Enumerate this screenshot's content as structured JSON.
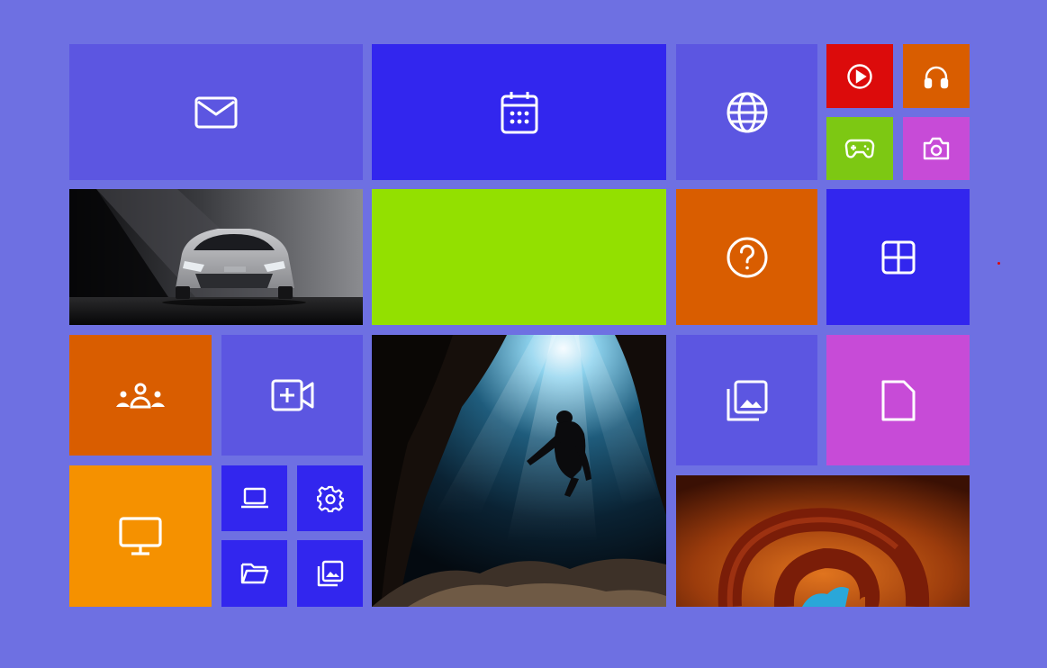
{
  "colors": {
    "background": "#6e70e2",
    "indigo": "#5c56e1",
    "blue": "#3226ee",
    "lime": "#93e000",
    "orange": "#d95d00",
    "amber": "#f59100",
    "red": "#dc0b0b",
    "magenta": "#c74bd7",
    "green": "#7dc813"
  },
  "tiles": [
    {
      "name": "mail-tile",
      "icon": "mail-icon"
    },
    {
      "name": "calendar-tile",
      "icon": "calendar-icon"
    },
    {
      "name": "browser-tile",
      "icon": "globe-icon"
    },
    {
      "name": "video-player-tile",
      "icon": "play-circle-icon"
    },
    {
      "name": "music-tile",
      "icon": "headphones-icon"
    },
    {
      "name": "games-tile",
      "icon": "gamepad-icon"
    },
    {
      "name": "camera-tile",
      "icon": "camera-icon"
    },
    {
      "name": "car-photo-tile",
      "icon": "car-photo"
    },
    {
      "name": "lime-tile",
      "icon": ""
    },
    {
      "name": "help-tile",
      "icon": "help-circle-icon"
    },
    {
      "name": "windows-tile",
      "icon": "windows-icon"
    },
    {
      "name": "people-tile",
      "icon": "people-icon"
    },
    {
      "name": "video-call-tile",
      "icon": "video-add-icon"
    },
    {
      "name": "diver-photo-tile",
      "icon": "diver-photo"
    },
    {
      "name": "gallery-tile",
      "icon": "photo-gallery-icon"
    },
    {
      "name": "document-tile",
      "icon": "document-icon"
    },
    {
      "name": "desktop-tile",
      "icon": "monitor-icon"
    },
    {
      "name": "laptop-tile",
      "icon": "laptop-icon"
    },
    {
      "name": "settings-tile",
      "icon": "gear-icon"
    },
    {
      "name": "files-tile",
      "icon": "folder-icon"
    },
    {
      "name": "photos-tile",
      "icon": "photos-icon"
    },
    {
      "name": "threads-photo-tile",
      "icon": "threads-logo-photo"
    }
  ]
}
